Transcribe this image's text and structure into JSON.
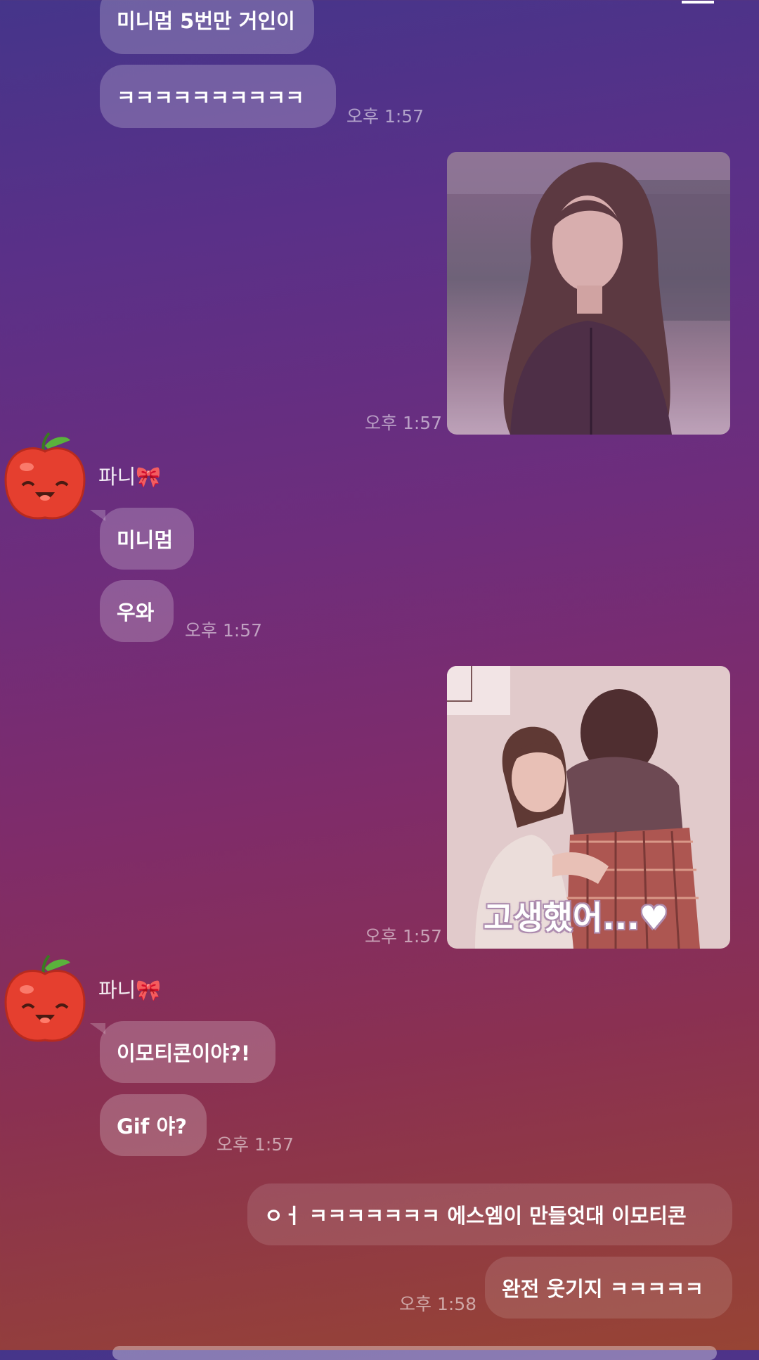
{
  "messages": {
    "m0_text": "미니멈 5번만 거인이",
    "m1_text": "ㅋㅋㅋㅋㅋㅋㅋㅋㅋㅋ",
    "m1_time": "오후 1:57",
    "img1_time": "오후 1:57",
    "sender_name": "파니🎀",
    "m2_text": "미니멈",
    "m3_text": "우와",
    "m3_time": "오후 1:57",
    "img2_time": "오후 1:57",
    "img2_caption": "고생했어...♥",
    "sender_name2": "파니🎀",
    "m4_text": "이모티콘이야?!",
    "m5_text": "Gif 야?",
    "m5_time": "오후 1:57",
    "m6_text": "ㅇㅓ ㅋㅋㅋㅋㅋㅋㅋ 에스엠이 만들엇대 이모티콘",
    "m7_text": "완전 웃기지 ㅋㅋㅋㅋㅋ",
    "m7_time": "오후 1:58"
  },
  "icons": {
    "back": "back-arrow-icon",
    "search": "search-icon",
    "menu": "menu-icon",
    "avatar": "apple-avatar-icon"
  },
  "colors": {
    "bg_top": "#45358a",
    "bg_mid": "#7f2c6a",
    "bg_bottom": "#974434"
  }
}
